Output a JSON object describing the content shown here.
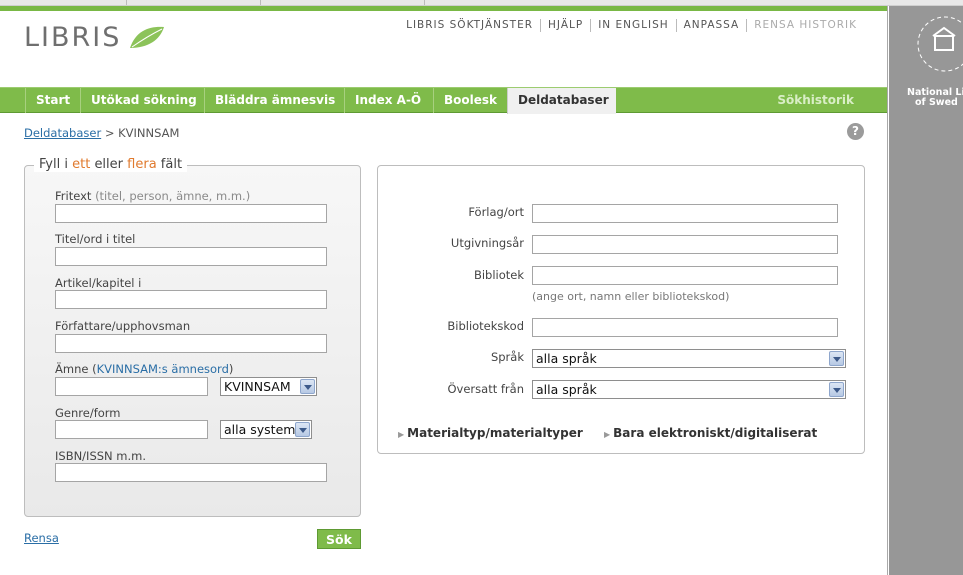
{
  "brand": {
    "logo": "LIBRIS"
  },
  "toplinks": [
    "LIBRIS SÖKTJÄNSTER",
    "HJÄLP",
    "IN ENGLISH",
    "ANPASSA",
    "RENSA HISTORIK"
  ],
  "nav": {
    "items": [
      "Start",
      "Utökad sökning",
      "Bläddra ämnesvis",
      "Index A-Ö",
      "Boolesk",
      "Deldatabaser"
    ],
    "active": "Deldatabaser",
    "history": "Sökhistorik"
  },
  "breadcrumb": {
    "link": "Deldatabaser",
    "separator": ">",
    "current": "KVINNSAM"
  },
  "help": "?",
  "legend": {
    "part1": "Fyll i",
    "part2": "ett",
    "part3": "eller",
    "part4": "flera",
    "part5": "fält"
  },
  "left": {
    "fritext_label": "Fritext",
    "fritext_hint": "(titel, person, ämne, m.m.)",
    "titel_label": "Titel/ord i titel",
    "artikel_label": "Artikel/kapitel i",
    "forfattare_label": "Författare/upphovsman",
    "amne_label": "Ämne (",
    "amne_link": "KVINNSAM:s ämnesord",
    "amne_close": ")",
    "amne_select": "KVINNSAM",
    "genre_label": "Genre/form",
    "genre_select": "alla system",
    "isbn_label": "ISBN/ISSN m.m."
  },
  "right": {
    "forlag_label": "Förlag/ort",
    "utgivning_label": "Utgivningsår",
    "bibliotek_label": "Bibliotek",
    "bibliotek_note": "(ange ort, namn eller bibliotekskod)",
    "bibliotekskod_label": "Bibliotekskod",
    "sprak_label": "Språk",
    "sprak_select": "alla språk",
    "oversatt_label": "Översatt från",
    "oversatt_select": "alla språk",
    "toggle1": "Materialtyp/materialtyper",
    "toggle2": "Bara elektroniskt/digitaliserat"
  },
  "actions": {
    "rensa": "Rensa",
    "sok": "Sök"
  },
  "side": {
    "line1": "National Li",
    "line2": "of Swed"
  },
  "colors": {
    "green": "#7fbb4a",
    "orange": "#e07a2e",
    "link": "#2a6ea6"
  }
}
